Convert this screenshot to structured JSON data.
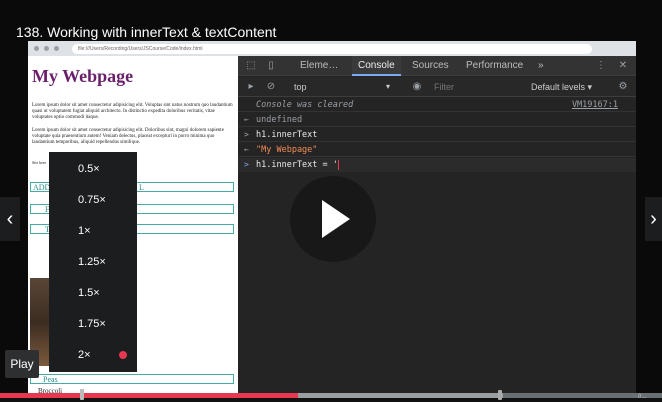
{
  "video": {
    "title": "138. Working with innerText & textContent",
    "play_tooltip": "Play",
    "progress_fraction": 0.45,
    "buffer_fraction": 0.76,
    "corner_text": "//..."
  },
  "browser": {
    "address": "file:///Users/Recording/Users/JSCourse/Code/index.html"
  },
  "webpage": {
    "heading": "My Webpage",
    "paragraph1": "Lorem ipsum dolor sit amet consectetur adipisicing elit. Voluptas sint natus nostrum quo laudantium quasi ut voluptatem fugiat aliquid architecto. In distinctio expedita doloribus veritatis, vitae voluptates optio commodi itaque.",
    "paragraph2": "Lorem ipsum dolor sit amet consectetur adipisicing elit. Doloribus sint, magni dolorem sapiente voluptate quia praesentium autem! Veniam delectus, placeat excepturi in porro minima quo laudantium temporibus, aliquid repellendus similique.",
    "small_text": "Site here",
    "add_box": "ADD",
    "add_box_tail": "L",
    "list_item1": "F",
    "list_item2": "T",
    "peas": "Peas",
    "broccoli": "Broccoli"
  },
  "speed_menu": {
    "options": [
      "0.5×",
      "0.75×",
      "1×",
      "1.25×",
      "1.5×",
      "1.75×",
      "2×"
    ],
    "selected": "2×",
    "accent": "#e8384f"
  },
  "devtools": {
    "tabs": [
      "Eleme…",
      "Console",
      "Sources",
      "Performance"
    ],
    "more": "»",
    "context": "top",
    "filter_placeholder": "Filter",
    "levels": "Default levels ▾",
    "lines": [
      {
        "prefix": "",
        "text": "Console was cleared",
        "color": "#9aa0a6",
        "italic": true,
        "link": "VM19167:1"
      },
      {
        "prefix": "←",
        "text": "undefined",
        "color": "#9aa0a6"
      },
      {
        "prefix": ">",
        "text": "h1.innerText",
        "color": "#e8eaed"
      },
      {
        "prefix": "←",
        "text": "\"My Webpage\"",
        "color": "#f28b54"
      },
      {
        "prefix": ">",
        "text": "h1.innerText = '",
        "color": "#e8eaed"
      }
    ]
  }
}
